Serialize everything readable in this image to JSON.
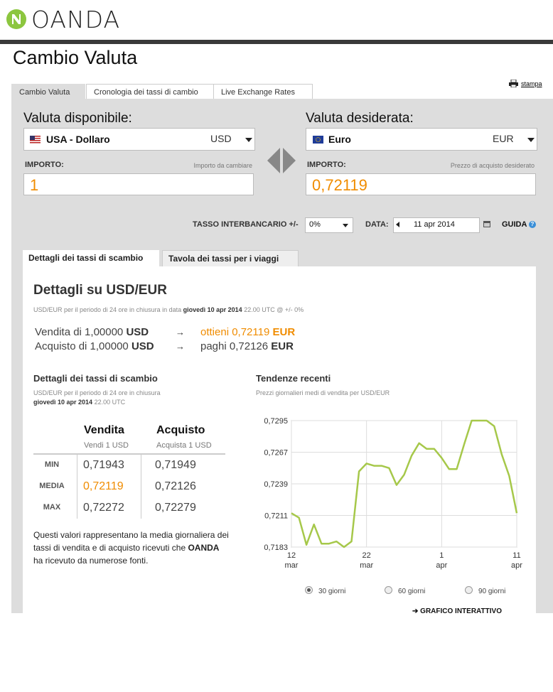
{
  "brand": {
    "name": "OANDA",
    "color": "#8cc63f"
  },
  "page_title": "Cambio Valuta",
  "top_tabs": [
    {
      "label": "Cambio Valuta",
      "active": true
    },
    {
      "label": "Cronologia dei tassi di cambio",
      "active": false
    },
    {
      "label": "Live Exchange Rates",
      "active": false
    }
  ],
  "print_label": "stampa",
  "from": {
    "heading": "Valuta disponibile:",
    "currency": "USA - Dollaro",
    "code": "USD",
    "amount_label": "IMPORTO:",
    "amount_hint": "Importo da cambiare",
    "amount": "1"
  },
  "to": {
    "heading": "Valuta desiderata:",
    "currency": "Euro",
    "code": "EUR",
    "amount_label": "IMPORTO:",
    "amount_hint": "Prezzo di acquisto desiderato",
    "amount": "0,72119"
  },
  "options": {
    "interbank_label": "TASSO INTERBANCARIO +/-",
    "interbank_value": "0%",
    "date_label": "DATA:",
    "date_value": "11 apr 2014",
    "help_label": "GUIDA"
  },
  "inner_tabs": [
    {
      "label": "Dettagli dei tassi di scambio",
      "active": true
    },
    {
      "label": "Tavola dei tassi per i viaggi",
      "active": false
    }
  ],
  "details": {
    "title": "Dettagli su USD/EUR",
    "period_prefix": "USD/EUR per il periodo di 24 ore in chiusura in data",
    "period_date": "giovedì 10 apr 2014",
    "period_suffix": "22.00 UTC @ +/- 0%",
    "sell_line": {
      "left": "Vendita di 1,00000",
      "left_code": "USD",
      "arrow": "→",
      "right": "ottieni 0,72119",
      "right_code": "EUR"
    },
    "buy_line": {
      "left": "Acquisto di 1,00000",
      "left_code": "USD",
      "arrow": "→",
      "right": "paghi 0,72126",
      "right_code": "EUR"
    }
  },
  "rates": {
    "heading": "Dettagli dei tassi di scambio",
    "sub1": "USD/EUR per il periodo di 24 ore in chiusura",
    "sub2_date": "giovedì 10 apr 2014",
    "sub2_time": "22.00 UTC",
    "col_sell": "Vendita",
    "col_sell_sub": "Vendi 1 USD",
    "col_buy": "Acquisto",
    "col_buy_sub": "Acquista 1 USD",
    "rows": [
      {
        "label": "MIN",
        "sell": "0,71943",
        "buy": "0,71949"
      },
      {
        "label": "MEDIA",
        "sell": "0,72119",
        "buy": "0,72126"
      },
      {
        "label": "MAX",
        "sell": "0,72272",
        "buy": "0,72279"
      }
    ],
    "note_pre": "Questi valori rappresentano la media giornaliera dei tassi di vendita e di acquisto ricevuti che",
    "note_brand": "OANDA",
    "note_post": "ha ricevuto da numerose fonti."
  },
  "trend": {
    "heading": "Tendenze recenti",
    "sub": "Prezzi giornalieri medi di vendita per USD/EUR",
    "radios": [
      {
        "label": "30 giorni",
        "checked": true
      },
      {
        "label": "60 giorni",
        "checked": false
      },
      {
        "label": "90 giorni",
        "checked": false
      }
    ],
    "interactive_link": "GRAFICO INTERATTIVO"
  },
  "chart_data": {
    "type": "line",
    "title": "",
    "xlabel": "",
    "ylabel": "",
    "ylim": [
      0.7183,
      0.7295
    ],
    "y_ticks": [
      "0,7295",
      "0,7267",
      "0,7239",
      "0,7211",
      "0,7183"
    ],
    "y_tick_values": [
      0.7295,
      0.7267,
      0.7239,
      0.7211,
      0.7183
    ],
    "x_ticks": [
      {
        "day": "12",
        "month": "mar",
        "index": 0
      },
      {
        "day": "22",
        "month": "mar",
        "index": 10
      },
      {
        "day": "1",
        "month": "apr",
        "index": 20
      },
      {
        "day": "11",
        "month": "apr",
        "index": 30
      }
    ],
    "series": [
      {
        "color": "#a6c84a",
        "values": [
          0.7213,
          0.7209,
          0.7185,
          0.7203,
          0.7186,
          0.7186,
          0.7188,
          0.7183,
          0.7188,
          0.725,
          0.7257,
          0.7255,
          0.7255,
          0.7253,
          0.7238,
          0.7247,
          0.7264,
          0.7275,
          0.727,
          0.727,
          0.7262,
          0.7252,
          0.7252,
          0.7274,
          0.7295,
          0.7295,
          0.7295,
          0.729,
          0.7265,
          0.7246,
          0.7213
        ]
      }
    ],
    "grid": true
  }
}
